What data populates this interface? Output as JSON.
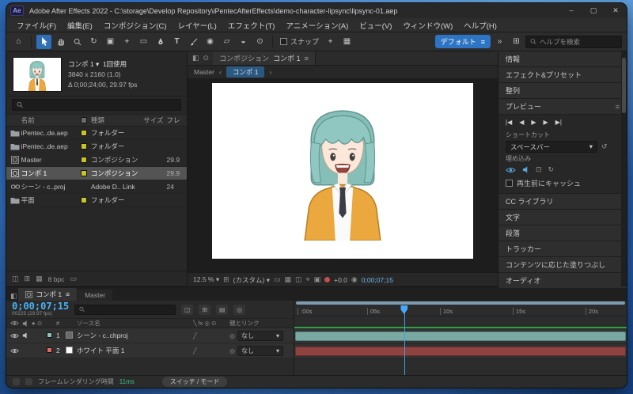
{
  "colors": {
    "accent_blue": "#2d74c4",
    "timecode_cyan": "#49b3f7",
    "render_green": "#3cc08e",
    "label_yellow": "#c9c32a",
    "layer1_bar": "#7aa8a2",
    "layer2_bar": "#8e4340"
  },
  "titlebar": {
    "app_label": "Ae",
    "title": "Adobe After Effects 2022 - C:\\storage\\Develop Repository\\iPentecAfterEffects\\demo-character-lipsync\\lipsync-01.aep",
    "minimize": "–",
    "maximize": "▢",
    "close": "✕"
  },
  "menubar": {
    "items": [
      "ファイル(F)",
      "編集(E)",
      "コンポジション(C)",
      "レイヤー(L)",
      "エフェクト(T)",
      "アニメーション(A)",
      "ビュー(V)",
      "ウィンドウ(W)",
      "ヘルプ(H)"
    ]
  },
  "toolbar": {
    "snap_label": "スナップ",
    "workspace": "デフォルト",
    "overflow": "»",
    "search_placeholder": "ヘルプを検索",
    "tools": [
      "home-icon",
      "selection-tool",
      "hand-tool",
      "zoom-tool",
      "orbit-tool",
      "camera-tool",
      "pan-behind-tool",
      "shape-tool",
      "pen-tool",
      "type-tool",
      "brush-tool",
      "clone-stamp-tool",
      "eraser-tool",
      "roto-brush-tool",
      "puppet-pin-tool"
    ]
  },
  "project": {
    "preview_name": "コンポ 1",
    "preview_usage": "1回使用",
    "preview_resolution": "3840 x 2160 (1.0)",
    "preview_duration": "Δ 0;00;24;00, 29.97 fps",
    "columns": {
      "name": "名前",
      "type": "種類",
      "size": "サイズ",
      "frame": "フレ"
    },
    "rows": [
      {
        "name": "iPentec..de.aep",
        "type": "フォルダー",
        "size": "",
        "frame": "",
        "label_style": "background:#c9c32a"
      },
      {
        "name": "iPentec..de.aep",
        "type": "フォルダー",
        "size": "",
        "frame": "",
        "label_style": "background:#c9c32a"
      },
      {
        "name": "Master",
        "type": "コンポジション",
        "size": "",
        "frame": "29.9",
        "label_style": "background:#c9c32a"
      },
      {
        "name": "コンポ 1",
        "type": "コンポジション",
        "size": "",
        "frame": "29.9",
        "label_style": "background:#c9c32a"
      },
      {
        "name": "シーン - c..proj",
        "type": "Adobe D.. Link",
        "size": "",
        "frame": "24",
        "label_style": "visibility:hidden"
      },
      {
        "name": "平面",
        "type": "フォルダー",
        "size": "",
        "frame": "",
        "label_style": "background:#c9c32a"
      }
    ],
    "bpc": "8 bpc"
  },
  "composition": {
    "panel_title": "コンポジション",
    "active_comp": "コンポ 1",
    "crumb_master": "Master",
    "crumb_comp": "コンポ 1",
    "zoom": "12.5 %",
    "view_preset": "(カスタム)",
    "exposure": "+0.0",
    "timecode": "0;00;07;15"
  },
  "right_panel": {
    "sections_top": [
      "情報",
      "エフェクト&プリセット",
      "整列"
    ],
    "preview": {
      "title": "プレビュー",
      "buttons": [
        "|◀",
        "◀",
        "▶",
        "▶",
        "▶|"
      ],
      "shortcut_label": "ショートカット",
      "shortcut_value": "スペースバー",
      "include_label": "埋め込み",
      "cache_label": "再生前にキャッシュ"
    },
    "sections_bottom": [
      "CC ライブラリ",
      "文字",
      "段落",
      "トラッカー",
      "コンテンツに応じた塗りつぶし",
      "オーディオ"
    ]
  },
  "timeline": {
    "tab_active": "コンポ 1",
    "tab_inactive": "Master",
    "timecode": "0;00;07;15",
    "frame_info": "00225 (29.97 fps)",
    "columns": {
      "hash": "#",
      "source": "ソース名",
      "switches": "╲ fx ◎ ⊙",
      "parent": "親とリンク"
    },
    "ruler": [
      ":00s",
      "05s",
      "10s",
      "15s",
      "20s"
    ],
    "layers": [
      {
        "index": "1",
        "name": "シーン - c..chproj",
        "parent": "なし",
        "swatch_style": "background:#8fc0ba",
        "bar_style": "background:#7aa8a2;border-color:#55837d"
      },
      {
        "index": "2",
        "name": "ホワイト 平面 1",
        "parent": "なし",
        "swatch_style": "background:#e06a60",
        "bar_style": "background:#8e4340;border-color:#67302e"
      }
    ]
  },
  "statusbar": {
    "render_label": "フレームレンダリング時間",
    "render_value": "11ms",
    "switch_mode": "スイッチ / モード"
  }
}
